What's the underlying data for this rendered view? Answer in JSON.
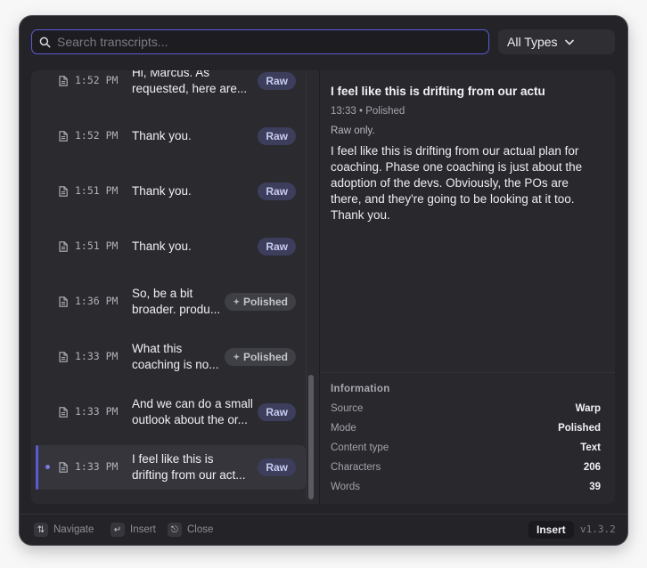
{
  "search": {
    "placeholder": "Search transcripts..."
  },
  "filter": {
    "label": "All Types"
  },
  "transcripts": [
    {
      "time": "1:52 PM",
      "line1": "Hi, Marcus. As",
      "line2": "requested, here are...",
      "type": "Raw"
    },
    {
      "time": "1:52 PM",
      "line1": "Thank you.",
      "line2": "",
      "type": "Raw"
    },
    {
      "time": "1:51 PM",
      "line1": "Thank you.",
      "line2": "",
      "type": "Raw"
    },
    {
      "time": "1:51 PM",
      "line1": "Thank you.",
      "line2": "",
      "type": "Raw"
    },
    {
      "time": "1:36 PM",
      "line1": "So, be a bit",
      "line2": "broader. produ...",
      "type": "Polished"
    },
    {
      "time": "1:33 PM",
      "line1": "What this",
      "line2": "coaching is no...",
      "type": "Polished"
    },
    {
      "time": "1:33 PM",
      "line1": "And we can do a small",
      "line2": "outlook about the or...",
      "type": "Raw"
    },
    {
      "time": "1:33 PM",
      "line1": "I feel like this is",
      "line2": "drifting from our act...",
      "type": "Raw",
      "selected": true
    }
  ],
  "detail": {
    "title": "I feel like this is drifting from our actu",
    "meta": "13:33 • Polished",
    "note": "Raw only.",
    "body": "I feel like this is drifting from our actual plan for coaching. Phase one coaching is just about the adoption of the devs. Obviously, the POs are there, and they're going to be looking at it too. Thank you."
  },
  "info": {
    "heading": "Information",
    "rows": [
      {
        "key": "Source",
        "value": "Warp"
      },
      {
        "key": "Mode",
        "value": "Polished"
      },
      {
        "key": "Content type",
        "value": "Text"
      },
      {
        "key": "Characters",
        "value": "206"
      },
      {
        "key": "Words",
        "value": "39"
      }
    ]
  },
  "footer": {
    "navigate": "Navigate",
    "insert": "Insert",
    "close": "Close",
    "insert_button": "Insert",
    "version": "v1.3.2"
  },
  "colors": {
    "accent": "#5b5bd6",
    "raw_badge": "#3c3e5c",
    "polished_badge": "#3f3f46"
  }
}
